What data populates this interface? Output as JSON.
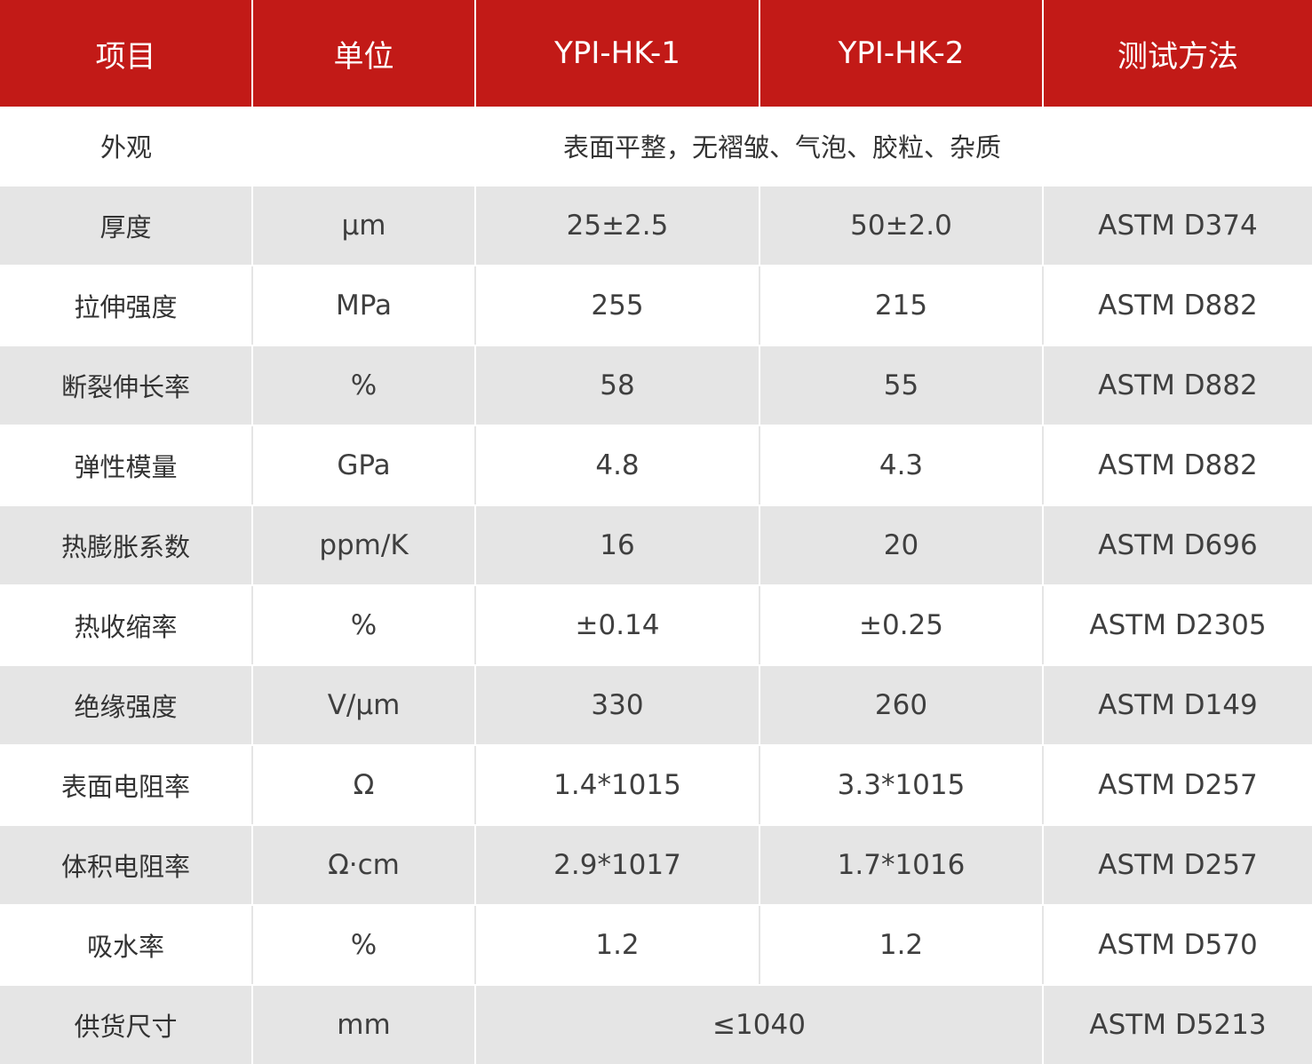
{
  "headers": [
    "项目",
    "单位",
    "YPI-HK-1",
    "YPI-HK-2",
    "测试方法"
  ],
  "appearance": {
    "item": "外观",
    "description": "表面平整，无褶皱、气泡、胶粒、杂质"
  },
  "rows": [
    {
      "item": "厚度",
      "unit": "μm",
      "hk1": "25±2.5",
      "hk2": "50±2.0",
      "method": "ASTM D374"
    },
    {
      "item": "拉伸强度",
      "unit": "MPa",
      "hk1": "255",
      "hk2": "215",
      "method": "ASTM D882"
    },
    {
      "item": "断裂伸长率",
      "unit": "%",
      "hk1": "58",
      "hk2": "55",
      "method": "ASTM D882"
    },
    {
      "item": "弹性模量",
      "unit": "GPa",
      "hk1": "4.8",
      "hk2": "4.3",
      "method": "ASTM D882"
    },
    {
      "item": "热膨胀系数",
      "unit": "ppm/K",
      "hk1": "16",
      "hk2": "20",
      "method": "ASTM D696"
    },
    {
      "item": "热收缩率",
      "unit": "%",
      "hk1": "±0.14",
      "hk2": "±0.25",
      "method": "ASTM D2305"
    },
    {
      "item": "绝缘强度",
      "unit": "V/μm",
      "hk1": "330",
      "hk2": "260",
      "method": "ASTM D149"
    },
    {
      "item": "表面电阻率",
      "unit": "Ω",
      "hk1": "1.4*1015",
      "hk2": "3.3*1015",
      "method": "ASTM D257"
    },
    {
      "item": "体积电阻率",
      "unit": "Ω·cm",
      "hk1": "2.9*1017",
      "hk2": "1.7*1016",
      "method": "ASTM D257"
    },
    {
      "item": "吸水率",
      "unit": "%",
      "hk1": "1.2",
      "hk2": "1.2",
      "method": "ASTM D570"
    }
  ],
  "supply": {
    "item": "供货尺寸",
    "unit": "mm",
    "value": "≤1040",
    "method": "ASTM D5213"
  }
}
